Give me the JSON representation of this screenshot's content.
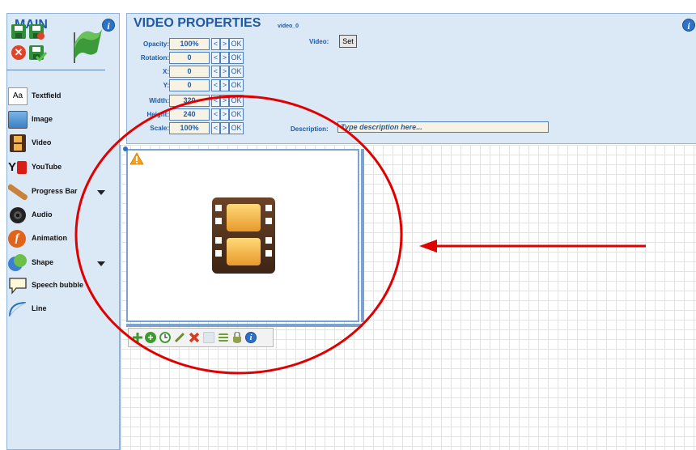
{
  "sidebar": {
    "title": "MAIN",
    "info_icon": "i",
    "quick_actions": [
      "save-icon",
      "save-as-icon",
      "cancel-icon",
      "save-and-close-icon",
      "flag-icon"
    ],
    "tools": [
      {
        "label": "Textfield",
        "icon": "textfield-icon",
        "icon_text": "Aa"
      },
      {
        "label": "Image",
        "icon": "image-icon"
      },
      {
        "label": "Video",
        "icon": "video-icon"
      },
      {
        "label": "YouTube",
        "icon": "youtube-icon",
        "icon_text": "Y"
      },
      {
        "label": "Progress Bar",
        "icon": "progress-bar-icon",
        "has_dropdown": true
      },
      {
        "label": "Audio",
        "icon": "audio-icon"
      },
      {
        "label": "Animation",
        "icon": "animation-icon",
        "icon_text": "f"
      },
      {
        "label": "Shape",
        "icon": "shape-icon",
        "has_dropdown": true
      },
      {
        "label": "Speech bubble",
        "icon": "speech-bubble-icon"
      },
      {
        "label": "Line",
        "icon": "line-icon"
      }
    ]
  },
  "properties": {
    "title": "VIDEO PROPERTIES",
    "subtitle": "video_0",
    "rows": [
      {
        "label": "Opacity:",
        "value": "100%"
      },
      {
        "label": "Rotation:",
        "value": "0"
      },
      {
        "label": "X:",
        "value": "0"
      },
      {
        "label": "Y:",
        "value": "0"
      },
      {
        "label": "Width:",
        "value": "320"
      },
      {
        "label": "Height:",
        "value": "240"
      },
      {
        "label": "Scale:",
        "value": "100%"
      }
    ],
    "btn_prev": "<",
    "btn_next": ">",
    "btn_ok": "OK",
    "video_label": "Video:",
    "video_set": "Set",
    "description_label": "Description:",
    "description_placeholder": "Type description here..."
  },
  "canvas": {
    "selected_element": "video_0",
    "warning_icon": "warning-icon",
    "placeholder_icon": "film-icon",
    "toolbar_icons": [
      "move-icon",
      "add-icon",
      "clock-icon",
      "edit-icon",
      "delete-icon",
      "blank-icon",
      "list-icon",
      "lock-icon",
      "info-icon"
    ]
  },
  "annotation": {
    "circle_color": "#e00000",
    "arrow_color": "#e00000"
  },
  "colors": {
    "accent": "#1f5aa6",
    "panel_bg": "#dbe9f7",
    "field_bg": "#f7f3e4"
  }
}
